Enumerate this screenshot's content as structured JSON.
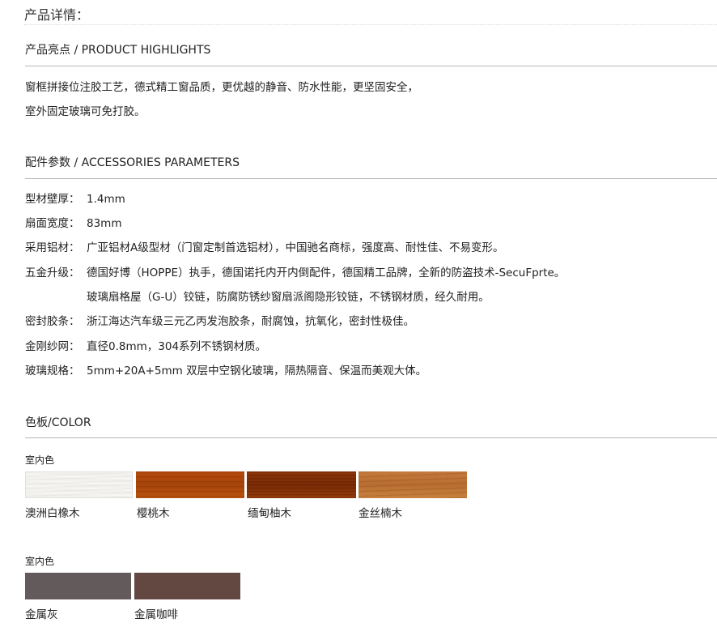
{
  "page_heading": "产品详情：",
  "highlights": {
    "title": "产品亮点 / PRODUCT HIGHLIGHTS",
    "line1": "窗框拼接位注胶工艺，德式精工窗品质，更优越的静音、防水性能，更坚固安全，",
    "line2": "室外固定玻璃可免打胶。"
  },
  "accessories": {
    "title": "配件参数 / ACCESSORIES PARAMETERS",
    "rows": [
      {
        "label": "型材壁厚：",
        "value": "1.4mm"
      },
      {
        "label": "扇面宽度：",
        "value": "83mm"
      },
      {
        "label": "采用铝材：",
        "value": "广亚铝材A级型材（门窗定制首选铝材），中国驰名商标，强度高、耐性佳、不易变形。"
      },
      {
        "label": "五金升级：",
        "value": "德国好博（HOPPE）执手，德国诺托内开内倒配件，德国精工品牌，全新的防盗技术-SecuFprte。"
      },
      {
        "label": "",
        "value": "玻璃扇格屋（G-U）铰链，防腐防锈纱窗扇派阁隐形铰链，不锈钢材质，经久耐用。"
      },
      {
        "label": "密封胶条：",
        "value": "浙江海达汽车级三元乙丙发泡胶条，耐腐蚀，抗氧化，密封性极佳。"
      },
      {
        "label": "金刚纱网：",
        "value": "直径0.8mm，304系列不锈钢材质。"
      },
      {
        "label": "玻璃规格：",
        "value": "5mm+20A+5mm 双层中空钢化玻璃，隔热隔音、保温而美观大体。"
      }
    ]
  },
  "color": {
    "title": "色板/COLOR",
    "groups": [
      {
        "label": "室内色",
        "swatches": [
          {
            "name": "澳洲白橡木",
            "color": "#f2f1ee"
          },
          {
            "name": "樱桃木",
            "color": "#ad470b"
          },
          {
            "name": "缅甸柚木",
            "color": "#823006"
          },
          {
            "name": "金丝楠木",
            "color": "#be7437"
          }
        ]
      },
      {
        "label": "室内色",
        "swatches": [
          {
            "name": "金属灰",
            "color": "#625a5b"
          },
          {
            "name": "金属咖啡",
            "color": "#634842"
          }
        ]
      }
    ]
  }
}
